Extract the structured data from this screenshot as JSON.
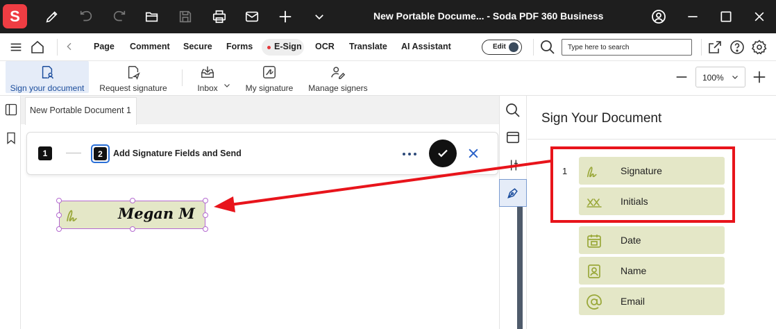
{
  "app": {
    "logo_letter": "S",
    "window_title": "New Portable Docume...   -  Soda PDF 360 Business",
    "accent_color": "#ef3d43"
  },
  "menu": {
    "items": [
      "Page",
      "Comment",
      "Secure",
      "Forms",
      "E-Sign",
      "OCR",
      "Translate",
      "AI Assistant"
    ],
    "active": "E-Sign",
    "edit_toggle_label": "Edit",
    "search_placeholder": "Type here to search"
  },
  "toolbar": {
    "tools": [
      "Sign your document",
      "Request signature",
      "Inbox",
      "My signature",
      "Manage signers"
    ],
    "active_tool": "Sign your document",
    "zoom": "100%"
  },
  "document": {
    "tab_title": "New Portable Document 1",
    "steps": {
      "step1_number": "1",
      "step2_number": "2",
      "step2_label": "Add Signature Fields and Send"
    },
    "signature_field_text": "Megan M"
  },
  "panel": {
    "title": "Sign Your Document",
    "signer_index": "1",
    "fields": [
      {
        "label": "Signature",
        "icon": "signature-icon"
      },
      {
        "label": "Initials",
        "icon": "initials-icon"
      },
      {
        "label": "Date",
        "icon": "calendar-icon"
      },
      {
        "label": "Name",
        "icon": "id-card-icon"
      },
      {
        "label": "Email",
        "icon": "at-sign-icon"
      }
    ],
    "field_color": "#e4e7c7",
    "field_icon_color": "#9aa83a"
  },
  "annotation": {
    "color": "#e8141b"
  }
}
